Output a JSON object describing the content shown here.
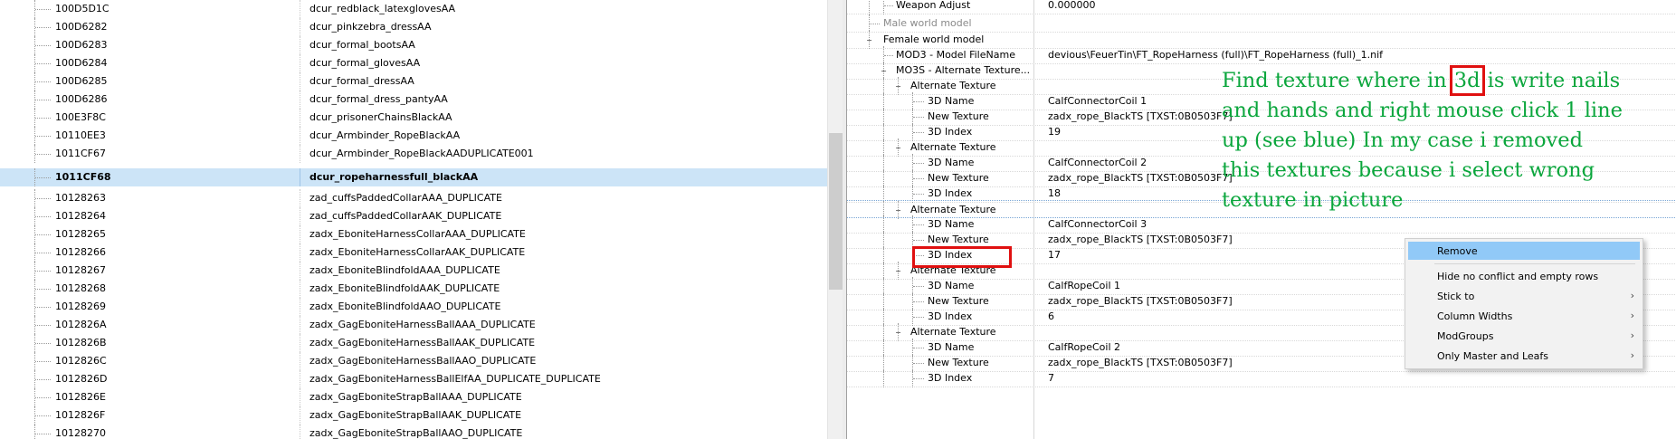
{
  "left_list": {
    "rows": [
      {
        "formid": "100D5D1C",
        "editor_id": "dcur_redblack_latexglovesAA"
      },
      {
        "formid": "100D6282",
        "editor_id": "dcur_pinkzebra_dressAA"
      },
      {
        "formid": "100D6283",
        "editor_id": "dcur_formal_bootsAA"
      },
      {
        "formid": "100D6284",
        "editor_id": "dcur_formal_glovesAA"
      },
      {
        "formid": "100D6285",
        "editor_id": "dcur_formal_dressAA"
      },
      {
        "formid": "100D6286",
        "editor_id": "dcur_formal_dress_pantyAA"
      },
      {
        "formid": "100E3F8C",
        "editor_id": "dcur_prisonerChainsBlackAA"
      },
      {
        "formid": "10110EE3",
        "editor_id": "dcur_Armbinder_RopeBlackAA"
      },
      {
        "formid": "1011CF67",
        "editor_id": "dcur_Armbinder_RopeBlackAADUPLICATE001"
      },
      {
        "formid": "1011CF68",
        "editor_id": "dcur_ropeharnessfull_blackAA",
        "selected": true
      },
      {
        "formid": "10128263",
        "editor_id": "zad_cuffsPaddedCollarAAA_DUPLICATE"
      },
      {
        "formid": "10128264",
        "editor_id": "zad_cuffsPaddedCollarAAK_DUPLICATE"
      },
      {
        "formid": "10128265",
        "editor_id": "zadx_EboniteHarnessCollarAAA_DUPLICATE"
      },
      {
        "formid": "10128266",
        "editor_id": "zadx_EboniteHarnessCollarAAK_DUPLICATE"
      },
      {
        "formid": "10128267",
        "editor_id": "zadx_EboniteBlindfoldAAA_DUPLICATE"
      },
      {
        "formid": "10128268",
        "editor_id": "zadx_EboniteBlindfoldAAK_DUPLICATE"
      },
      {
        "formid": "10128269",
        "editor_id": "zadx_EboniteBlindfoldAAO_DUPLICATE"
      },
      {
        "formid": "1012826A",
        "editor_id": "zadx_GagEboniteHarnessBallAAA_DUPLICATE"
      },
      {
        "formid": "1012826B",
        "editor_id": "zadx_GagEboniteHarnessBallAAK_DUPLICATE"
      },
      {
        "formid": "1012826C",
        "editor_id": "zadx_GagEboniteHarnessBallAAO_DUPLICATE"
      },
      {
        "formid": "1012826D",
        "editor_id": "zadx_GagEboniteHarnessBallElfAA_DUPLICATE_DUPLICATE"
      },
      {
        "formid": "1012826E",
        "editor_id": "zadx_GagEboniteStrapBallAAA_DUPLICATE"
      },
      {
        "formid": "1012826F",
        "editor_id": "zadx_GagEboniteStrapBallAAK_DUPLICATE"
      },
      {
        "formid": "10128270",
        "editor_id": "zadx_GagEboniteStrapBallAAO_DUPLICATE"
      }
    ]
  },
  "record_view": {
    "weapon_adjust": {
      "label": "Weapon Adjust",
      "value": "0.000000"
    },
    "male_world_model": {
      "label": "Male world model"
    },
    "female_world_model": {
      "label": "Female world model",
      "expander": "−"
    },
    "model_filename": {
      "label": "MOD3 - Model FileName",
      "value": "devious\\FeuerTin\\FT_RopeHarness (full)\\FT_RopeHarness (full)_1.nif"
    },
    "alt_textures_header": {
      "label": "MO3S - Alternate Texture...",
      "expander": "−"
    },
    "alt_textures": [
      {
        "label": "Alternate Texture",
        "name_label": "3D Name",
        "name": "CalfConnectorCoil 1",
        "tex_label": "New Texture",
        "texture": "zadx_rope_BlackTS [TXST:0B0503F7]",
        "idx_label": "3D Index",
        "index": "19"
      },
      {
        "label": "Alternate Texture",
        "name_label": "3D Name",
        "name": "CalfConnectorCoil 2",
        "tex_label": "New Texture",
        "texture": "zadx_rope_BlackTS [TXST:0B0503F7]",
        "idx_label": "3D Index",
        "index": "18"
      },
      {
        "label": "Alternate Texture",
        "name_label": "3D Name",
        "name": "CalfConnectorCoil 3",
        "tex_label": "New Texture",
        "texture": "zadx_rope_BlackTS [TXST:0B0503F7]",
        "idx_label": "3D Index",
        "index": "17"
      },
      {
        "label": "Alternate Texture",
        "name_label": "3D Name",
        "name": "CalfRopeCoil 1",
        "tex_label": "New Texture",
        "texture": "zadx_rope_BlackTS [TXST:0B0503F7]",
        "idx_label": "3D Index",
        "index": "6"
      },
      {
        "label": "Alternate Texture",
        "name_label": "3D Name",
        "name": "CalfRopeCoil 2",
        "tex_label": "New Texture",
        "texture": "zadx_rope_BlackTS [TXST:0B0503F7]",
        "idx_label": "3D Index",
        "index": "7"
      }
    ],
    "expander_symbol": "−"
  },
  "annotation": {
    "line1_pre": "Find texture where in ",
    "line1_key": "3d",
    "line1_post": " is write nails",
    "line2": "and hands and right mouse click 1 line",
    "line3": "up (see blue) In my case i removed",
    "line4": "this textures because i select wrong",
    "line5": "texture in picture"
  },
  "context_menu": {
    "items": [
      {
        "label": "Remove",
        "highlighted": true
      },
      {
        "label": "Hide no conflict and empty rows"
      },
      {
        "label": "Stick to",
        "submenu": true
      },
      {
        "label": "Column Widths",
        "submenu": true
      },
      {
        "label": "ModGroups",
        "submenu": true
      },
      {
        "label": "Only Master and Leafs",
        "submenu": true
      }
    ],
    "submenu_glyph": "›"
  },
  "colors": {
    "selection": "#cce4f7",
    "annotation_text": "#0aa63c",
    "highlight_box": "#e01010",
    "menu_highlight": "#91c9f7"
  }
}
